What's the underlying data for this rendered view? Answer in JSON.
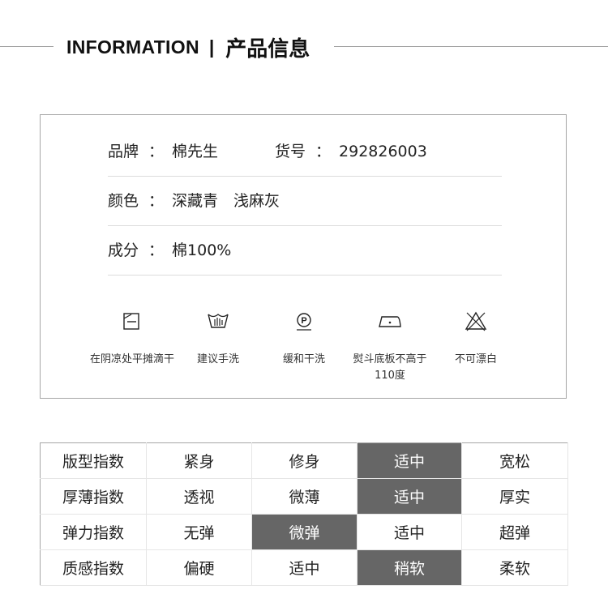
{
  "header": {
    "title_en": "INFORMATION",
    "separator": "|",
    "title_zh": "产品信息"
  },
  "info": {
    "brand_label": "品牌",
    "brand_value": "棉先生",
    "item_no_label": "货号",
    "item_no_value": "292826003",
    "color_label": "颜色",
    "color_values": "深藏青　浅麻灰",
    "material_label": "成分",
    "material_value": "棉100%",
    "colon": "："
  },
  "care": [
    {
      "icon": "flat-dry-shade-icon",
      "label": "在阴凉处平摊滴干"
    },
    {
      "icon": "hand-wash-icon",
      "label": "建议手洗"
    },
    {
      "icon": "dry-clean-p-icon",
      "label": "缓和干洗"
    },
    {
      "icon": "iron-low-icon",
      "label": "熨斗底板不高于110度"
    },
    {
      "icon": "do-not-bleach-icon",
      "label": "不可漂白"
    }
  ],
  "scale_table": {
    "selected_color": "#666666",
    "rows": [
      {
        "label": "版型指数",
        "options": [
          "紧身",
          "修身",
          "适中",
          "宽松"
        ],
        "selected": 2
      },
      {
        "label": "厚薄指数",
        "options": [
          "透视",
          "微薄",
          "适中",
          "厚实"
        ],
        "selected": 2
      },
      {
        "label": "弹力指数",
        "options": [
          "无弹",
          "微弹",
          "适中",
          "超弹"
        ],
        "selected": 1
      },
      {
        "label": "质感指数",
        "options": [
          "偏硬",
          "适中",
          "稍软",
          "柔软"
        ],
        "selected": 2
      }
    ]
  }
}
